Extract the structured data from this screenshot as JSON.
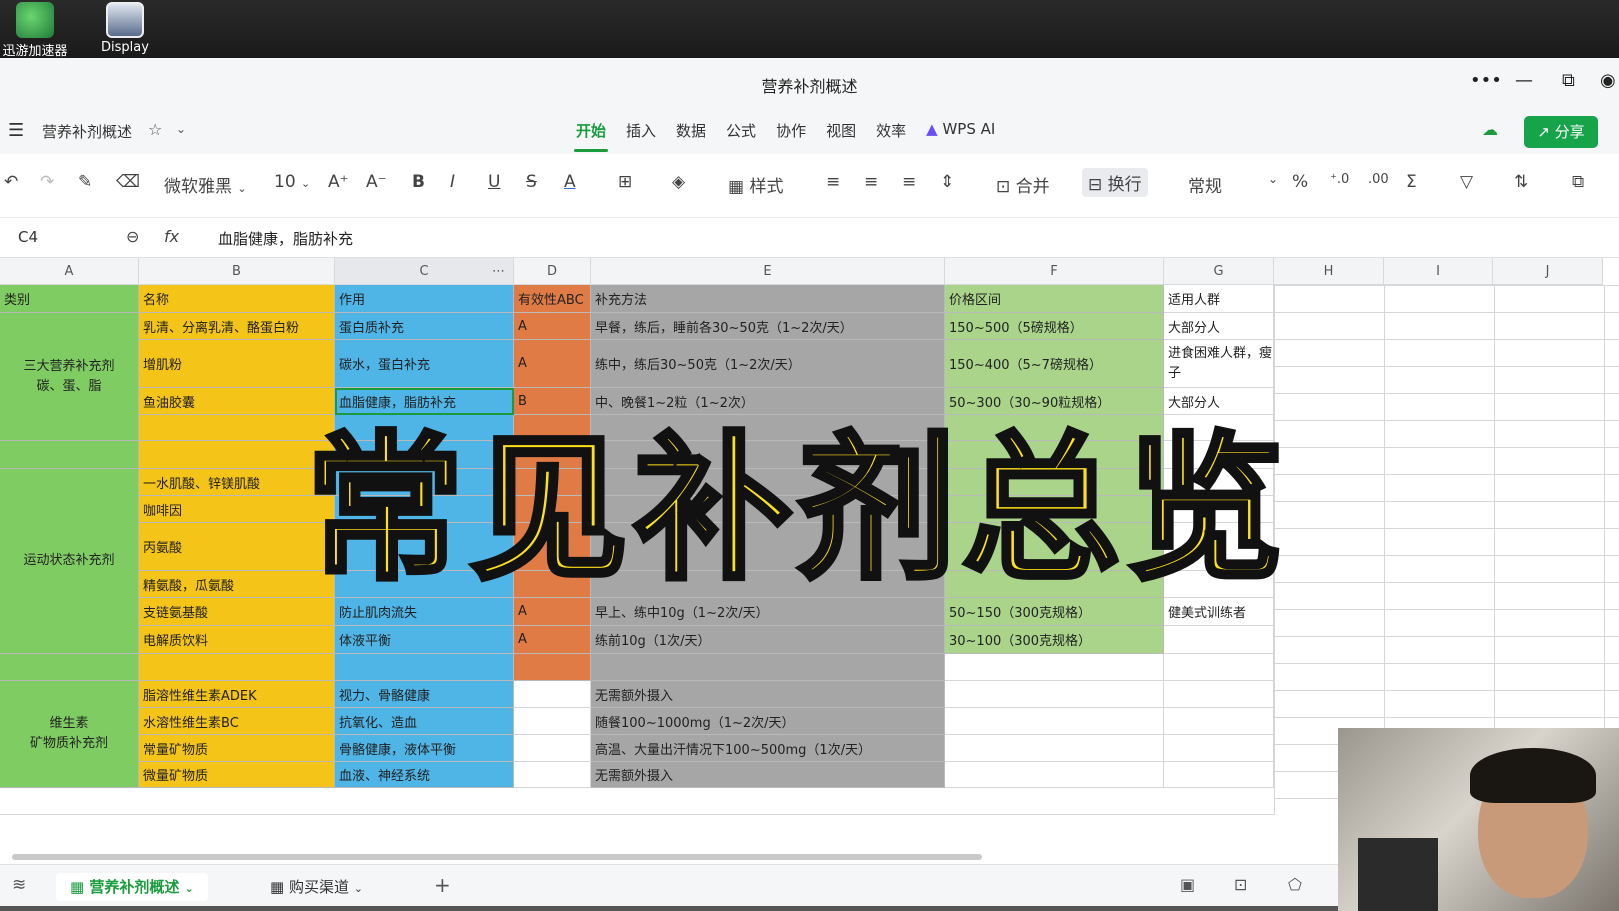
{
  "desktop": {
    "icons": [
      {
        "label": "迅游加速器",
        "icon": "accelerator-app-icon",
        "color": "#2fa84f"
      },
      {
        "label": "Display",
        "icon": "display-app-icon",
        "color": "#5a6b8c"
      }
    ]
  },
  "window": {
    "title": "营养补剂概述",
    "controls": [
      "•••",
      "—",
      "⧉"
    ]
  },
  "menubar": {
    "doc_name": "营养补剂概述",
    "tabs": [
      "开始",
      "插入",
      "数据",
      "公式",
      "协作",
      "视图",
      "效率",
      "WPS AI"
    ],
    "active_tab": "开始",
    "share_label": "分享"
  },
  "toolbar": {
    "font": "微软雅黑",
    "font_size": "10",
    "style_label": "样式",
    "merge_label": "合并",
    "wrap_label": "换行",
    "format": "常规"
  },
  "formula_bar": {
    "cell_ref": "C4",
    "fx": "fx",
    "content": "血脂健康，脂肪补充"
  },
  "columns": [
    "A",
    "B",
    "C",
    "D",
    "E",
    "F",
    "G",
    "H",
    "I",
    "J"
  ],
  "headers": {
    "a": "类别",
    "b": "名称",
    "c": "作用",
    "d": "有效性ABC",
    "e": "补充方法",
    "f": "价格区间",
    "g": "适用人群"
  },
  "groups": {
    "g1": "三大营养补充剂\n碳、蛋、脂",
    "g2": "运动状态补充剂",
    "g3": "维生素\n矿物质补充剂"
  },
  "rows": [
    {
      "b": "乳清、分离乳清、酪蛋白粉",
      "c": "蛋白质补充",
      "d": "A",
      "e": "早餐，练后，睡前各30~50克（1~2次/天）",
      "f": "150~500（5磅规格）",
      "g": "大部分人"
    },
    {
      "b": "增肌粉",
      "c": "碳水，蛋白补充",
      "d": "A",
      "e": "练中，练后30~50克（1~2次/天）",
      "f": "150~400（5~7磅规格）",
      "g": "进食困难人群，瘦子"
    },
    {
      "b": "鱼油胶囊",
      "c": "血脂健康，脂肪补充",
      "d": "B",
      "e": "中、晚餐1~2粒（1~2次）",
      "f": "50~300（30~90粒规格）",
      "g": "大部分人"
    },
    {
      "b": "",
      "c": "",
      "d": "",
      "e": "",
      "f": "",
      "g": ""
    },
    {
      "b": "",
      "c": "",
      "d": "",
      "e": "",
      "f": "",
      "g": ""
    },
    {
      "b": "一水肌酸、锌镁肌酸",
      "c": "",
      "d": "",
      "e": "",
      "f": "",
      "g": ""
    },
    {
      "b": "咖啡因",
      "c": "",
      "d": "",
      "e": "",
      "f": "",
      "g": ""
    },
    {
      "b": "丙氨酸",
      "c": "",
      "d": "",
      "e": "",
      "f": "",
      "g": ""
    },
    {
      "b": "精氨酸，瓜氨酸",
      "c": "",
      "d": "",
      "e": "",
      "f": "",
      "g": ""
    },
    {
      "b": "支链氨基酸",
      "c": "防止肌肉流失",
      "d": "A",
      "e": "早上、练中10g（1~2次/天）",
      "f": "50~150（300克规格）",
      "g": "健美式训练者"
    },
    {
      "b": "电解质饮料",
      "c": "体液平衡",
      "d": "A",
      "e": "练前10g（1次/天）",
      "f": "30~100（300克规格）",
      "g": ""
    },
    {
      "b": "",
      "c": "",
      "d": "",
      "e": "",
      "f": "",
      "g": ""
    },
    {
      "b": "脂溶性维生素ADEK",
      "c": "视力、骨骼健康",
      "d": "",
      "e": "无需额外摄入",
      "f": "",
      "g": ""
    },
    {
      "b": "水溶性维生素BC",
      "c": "抗氧化、造血",
      "d": "",
      "e": "随餐100~1000mg（1~2次/天）",
      "f": "",
      "g": ""
    },
    {
      "b": "常量矿物质",
      "c": "骨骼健康，液体平衡",
      "d": "",
      "e": "高温、大量出汗情况下100~500mg（1次/天）",
      "f": "",
      "g": ""
    },
    {
      "b": "微量矿物质",
      "c": "血液、神经系统",
      "d": "",
      "e": "无需额外摄入",
      "f": "",
      "g": ""
    }
  ],
  "sheet_tabs": [
    "营养补剂概述",
    "购买渠道"
  ],
  "active_sheet": "营养补剂概述",
  "overlay_title": "常见补剂总览",
  "colors": {
    "green": "#7fcc63",
    "yellow": "#f5c418",
    "blue": "#4fb4e6",
    "orange": "#e07b45",
    "gray": "#a6a6a6",
    "light_green": "#a9d48a",
    "accent": "#1a9c3e",
    "overlay_text": "#ffe11a"
  }
}
